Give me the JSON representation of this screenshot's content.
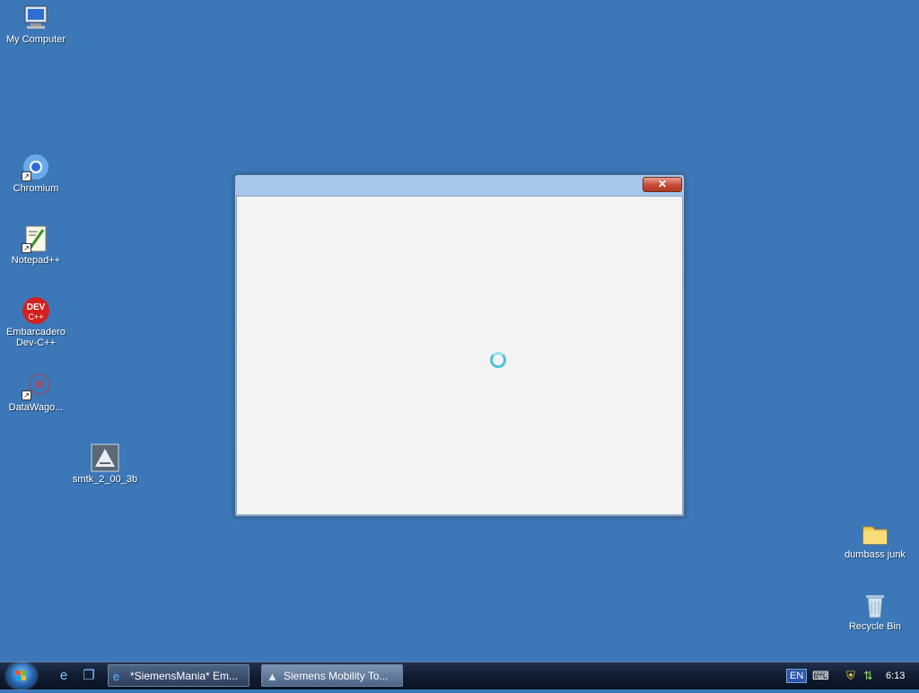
{
  "desktop": {
    "background": "#3c78b8",
    "icons": {
      "my_computer": "My Computer",
      "chromium": "Chromium",
      "notepadpp": "Notepad++",
      "devcpp": "Embarcadero\nDev-C++",
      "datawagon": "DataWago...",
      "smtk": "smtk_2_00_3b",
      "dumbass_junk": "dumbass junk",
      "recycle_bin": "Recycle Bin"
    }
  },
  "dialog": {
    "close_label": "✕",
    "state": "loading"
  },
  "taskbar": {
    "tasks": [
      {
        "label": "*SiemensMania* Em..."
      },
      {
        "label": "Siemens Mobility To..."
      }
    ],
    "tray": {
      "language": "EN",
      "time": "6:13"
    }
  }
}
